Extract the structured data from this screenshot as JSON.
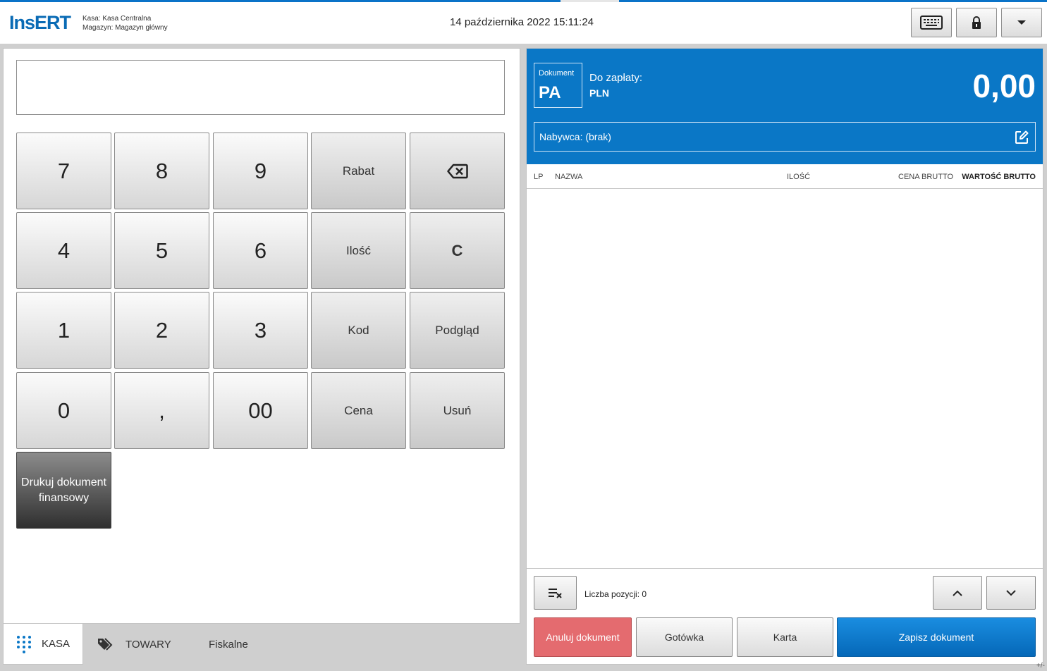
{
  "app": {
    "logo": "InsERT"
  },
  "header": {
    "kasa_label": "Kasa:",
    "kasa_value": "Kasa Centralna",
    "magazyn_label": "Magazyn:",
    "magazyn_value": "Magazyn główny",
    "datetime": "14 października 2022 15:11:24",
    "buttons": [
      "keyboard-icon",
      "lock-icon",
      "chevron-down-icon"
    ]
  },
  "keypad": {
    "row1": [
      "7",
      "8",
      "9",
      "Rabat"
    ],
    "row2": [
      "4",
      "5",
      "6",
      "Ilość",
      "C"
    ],
    "row3": [
      "1",
      "2",
      "3",
      "Kod",
      "Podgląd"
    ],
    "row4": [
      "0",
      ",",
      "00",
      "Cena",
      "Usuń"
    ],
    "print_line1": "Drukuj dokument",
    "print_line2": "finansowy"
  },
  "tabs": {
    "kasa": "KASA",
    "towary": "TOWARY",
    "fiskalne": "Fiskalne"
  },
  "document": {
    "type_label": "Dokument",
    "type_code": "PA",
    "pay_label": "Do zapłaty:",
    "currency": "PLN",
    "amount": "0,00",
    "buyer": "Nabywca: (brak)"
  },
  "table": {
    "columns": [
      "LP",
      "NAZWA",
      "ILOŚĆ",
      "CENA BRUTTO",
      "WARTOŚĆ BRUTTO"
    ],
    "rows": []
  },
  "footer": {
    "count_label": "Liczba pozycji: 0",
    "cancel": "Anuluj dokument",
    "cash": "Gotówka",
    "card": "Karta",
    "save": "Zapisz dokument",
    "plusminus": "+/-"
  },
  "colors": {
    "accent": "#0a77c6",
    "cancel": "#e46b6f",
    "save": "#0a77c6"
  }
}
